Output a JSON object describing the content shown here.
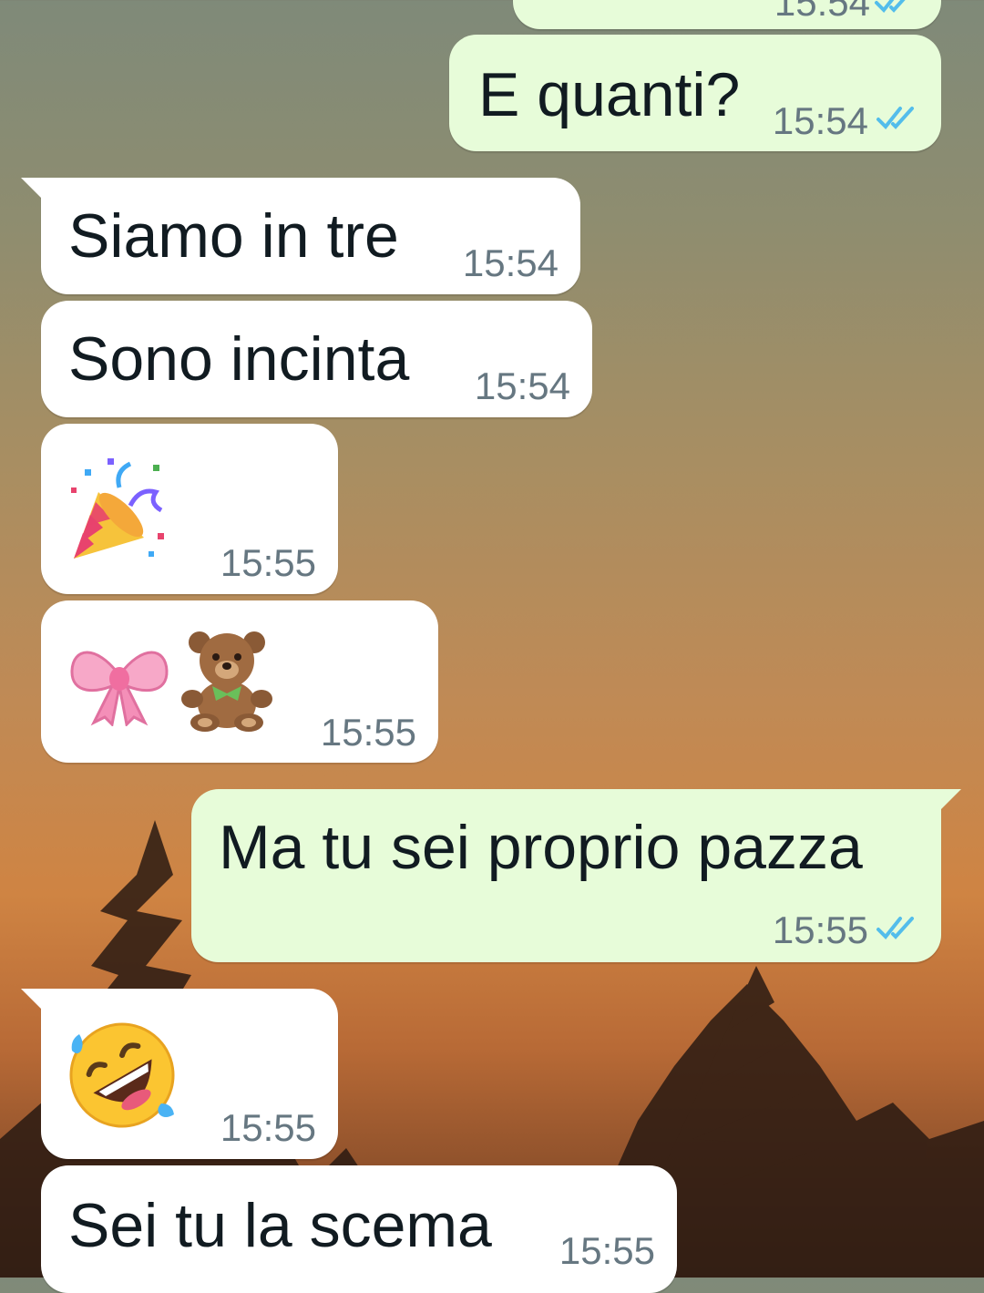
{
  "chat": {
    "messages": [
      {
        "id": "m0",
        "direction": "out",
        "text": "",
        "time": "15:54",
        "status": "read"
      },
      {
        "id": "m1",
        "direction": "out",
        "text": "E quanti?",
        "time": "15:54",
        "status": "read"
      },
      {
        "id": "m2",
        "direction": "in",
        "text": "Siamo in tre",
        "time": "15:54"
      },
      {
        "id": "m3",
        "direction": "in",
        "text": "Sono incinta",
        "time": "15:54"
      },
      {
        "id": "m4",
        "direction": "in",
        "emoji": [
          "party-popper"
        ],
        "time": "15:55"
      },
      {
        "id": "m5",
        "direction": "in",
        "emoji": [
          "ribbon-bow",
          "teddy-bear"
        ],
        "time": "15:55"
      },
      {
        "id": "m6",
        "direction": "out",
        "text": "Ma tu sei proprio pazza",
        "time": "15:55",
        "status": "read"
      },
      {
        "id": "m7",
        "direction": "in",
        "emoji": [
          "rolling-on-floor-laughing"
        ],
        "time": "15:55"
      },
      {
        "id": "m8",
        "direction": "in",
        "text": "Sei tu la scema",
        "time": "15:55"
      }
    ]
  },
  "colors": {
    "incoming_bubble": "#ffffff",
    "outgoing_bubble": "#e7fcd9",
    "read_ticks": "#53bdeb",
    "timestamp": "#667781",
    "text": "#111b21"
  }
}
